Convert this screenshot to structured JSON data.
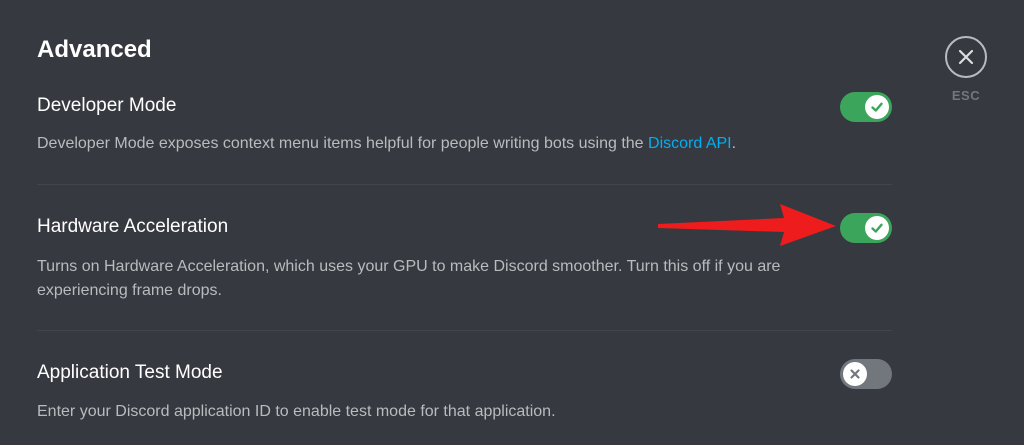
{
  "page": {
    "title": "Advanced"
  },
  "close": {
    "label": "ESC",
    "icon": "close-icon"
  },
  "settings": [
    {
      "title": "Developer Mode",
      "description_prefix": "Developer Mode exposes context menu items helpful for people writing bots using the ",
      "link_text": "Discord API",
      "description_suffix": ".",
      "enabled": true
    },
    {
      "title": "Hardware Acceleration",
      "description": "Turns on Hardware Acceleration, which uses your GPU to make Discord smoother. Turn this off if you are experiencing frame drops.",
      "enabled": true
    },
    {
      "title": "Application Test Mode",
      "description": "Enter your Discord application ID to enable test mode for that application.",
      "enabled": false
    }
  ],
  "colors": {
    "background": "#36393f",
    "toggle_on": "#3ba55c",
    "toggle_off": "#72767d",
    "link": "#00aff4",
    "annotation_arrow": "#ee1c1c"
  }
}
